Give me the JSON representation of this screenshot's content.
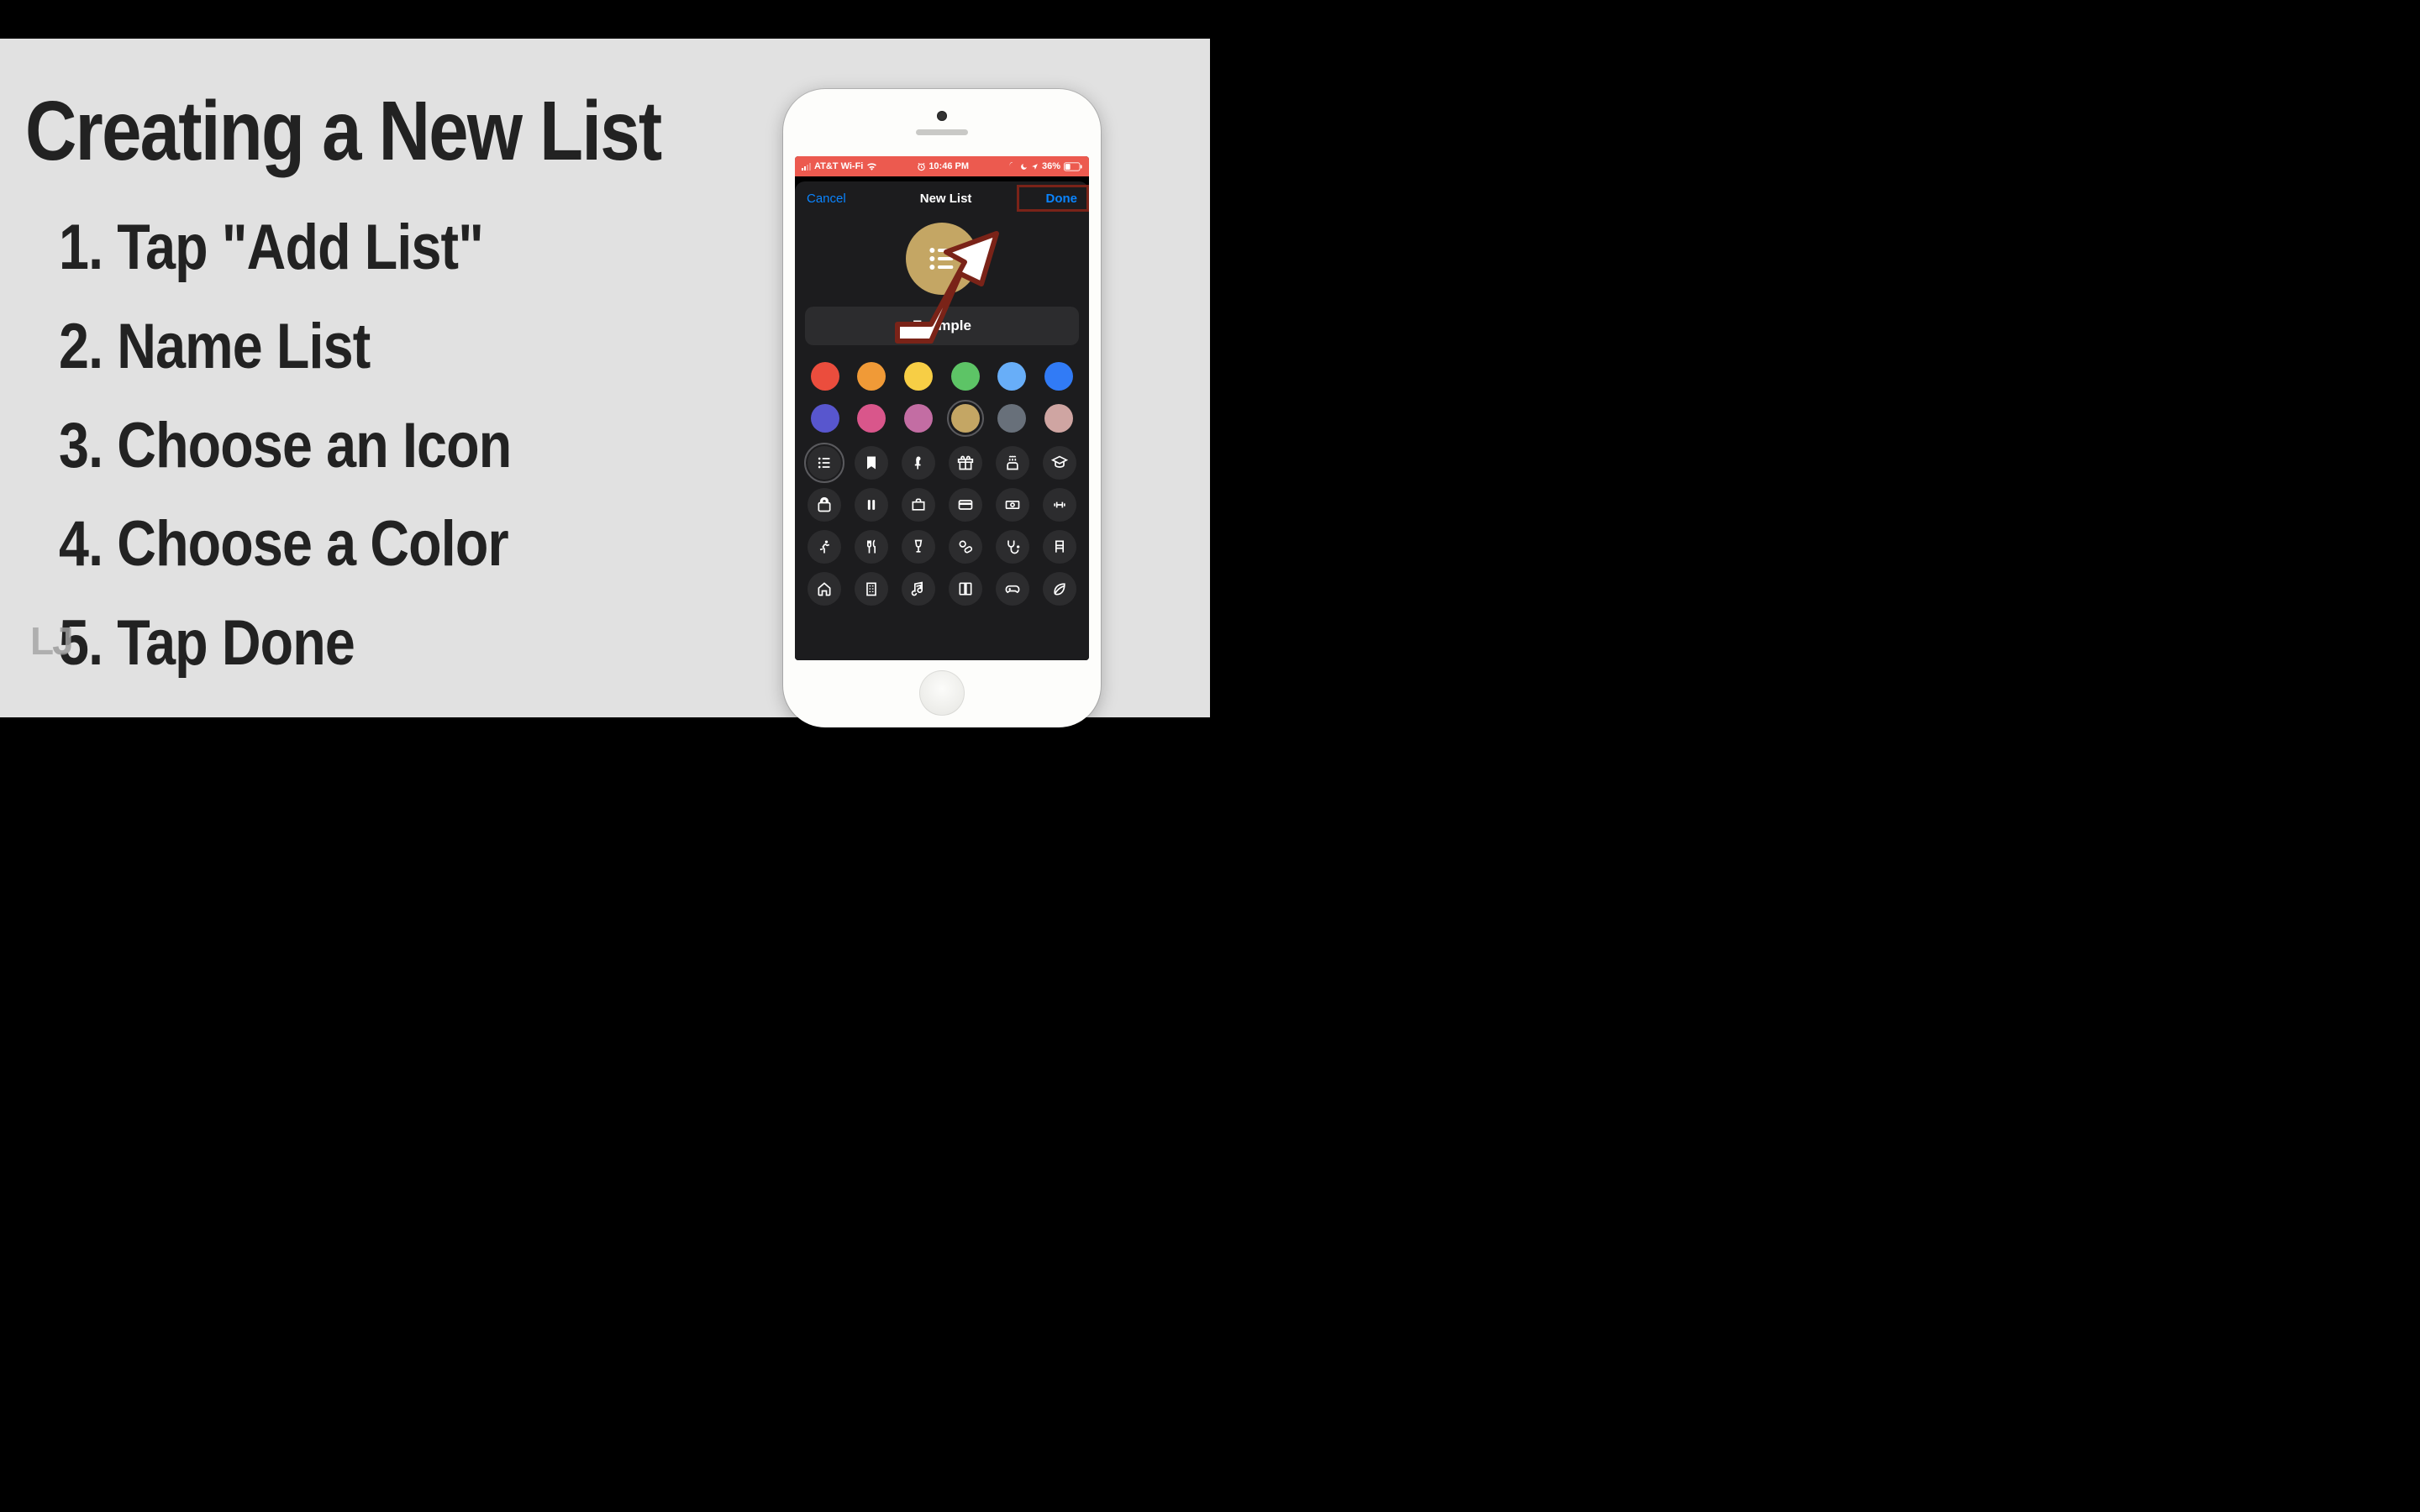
{
  "instructions": {
    "title": "Creating a New List",
    "steps": [
      "1. Tap \"Add List\"",
      "2. Name List",
      "3. Choose an Icon",
      "4. Choose a Color",
      "5. Tap Done"
    ]
  },
  "watermark": "LJ",
  "phone": {
    "status": {
      "carrier": "AT&T Wi-Fi",
      "time": "10:46 PM",
      "battery": "36%"
    },
    "sheet": {
      "cancel": "Cancel",
      "title": "New List",
      "done": "Done",
      "list_name": "Example",
      "colors": [
        {
          "name": "red",
          "hex": "#eb4d3d",
          "selected": false
        },
        {
          "name": "orange",
          "hex": "#f09a37",
          "selected": false
        },
        {
          "name": "yellow",
          "hex": "#f7ce45",
          "selected": false
        },
        {
          "name": "green",
          "hex": "#5dc466",
          "selected": false
        },
        {
          "name": "light-blue",
          "hex": "#68aef8",
          "selected": false
        },
        {
          "name": "blue",
          "hex": "#317bf6",
          "selected": false
        },
        {
          "name": "purple",
          "hex": "#5856ce",
          "selected": false
        },
        {
          "name": "pink",
          "hex": "#d9568b",
          "selected": false
        },
        {
          "name": "magenta",
          "hex": "#c36da3",
          "selected": false
        },
        {
          "name": "tan",
          "hex": "#c4a664",
          "selected": true
        },
        {
          "name": "gray",
          "hex": "#68707a",
          "selected": false
        },
        {
          "name": "rose",
          "hex": "#cfa5a2",
          "selected": false
        }
      ],
      "icons": [
        {
          "name": "list-bullet",
          "selected": true
        },
        {
          "name": "bookmark",
          "selected": false
        },
        {
          "name": "pin",
          "selected": false
        },
        {
          "name": "gift",
          "selected": false
        },
        {
          "name": "birthday-cake",
          "selected": false
        },
        {
          "name": "graduation-cap",
          "selected": false
        },
        {
          "name": "backpack",
          "selected": false
        },
        {
          "name": "pause",
          "selected": false
        },
        {
          "name": "briefcase",
          "selected": false
        },
        {
          "name": "credit-card",
          "selected": false
        },
        {
          "name": "money",
          "selected": false
        },
        {
          "name": "dumbbell",
          "selected": false
        },
        {
          "name": "running",
          "selected": false
        },
        {
          "name": "fork-knife",
          "selected": false
        },
        {
          "name": "wine-glass",
          "selected": false
        },
        {
          "name": "pills",
          "selected": false
        },
        {
          "name": "stethoscope",
          "selected": false
        },
        {
          "name": "chair",
          "selected": false
        },
        {
          "name": "house",
          "selected": false
        },
        {
          "name": "building",
          "selected": false
        },
        {
          "name": "music-note",
          "selected": false
        },
        {
          "name": "book",
          "selected": false
        },
        {
          "name": "game-controller",
          "selected": false
        },
        {
          "name": "leaf",
          "selected": false
        }
      ]
    }
  }
}
